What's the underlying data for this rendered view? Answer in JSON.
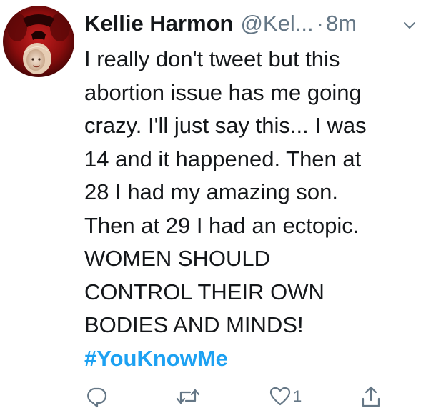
{
  "user": {
    "display_name": "Kellie Harmon",
    "handle": "@Kel...",
    "separator": "·",
    "timestamp": "8m",
    "avatar_icon": "profile-photo",
    "menu_icon": "chevron-down-icon"
  },
  "tweet": {
    "lines": [
      "I really don't tweet but this",
      "abortion issue has me going",
      "crazy. I'll just say this... I was",
      "14 and it happened. Then at",
      "28 I had my amazing son.",
      "Then at 29 I had an ectopic.",
      "WOMEN SHOULD",
      "CONTROL THEIR OWN",
      "BODIES AND MINDS!"
    ],
    "hashtag": "#YouKnowMe"
  },
  "actions": {
    "reply_icon": "reply-icon",
    "retweet_icon": "retweet-icon",
    "like_icon": "heart-icon",
    "like_count": "1",
    "share_icon": "share-icon"
  },
  "colors": {
    "text": "#14171a",
    "muted": "#657786",
    "link": "#1da1f2",
    "background": "#ffffff"
  }
}
